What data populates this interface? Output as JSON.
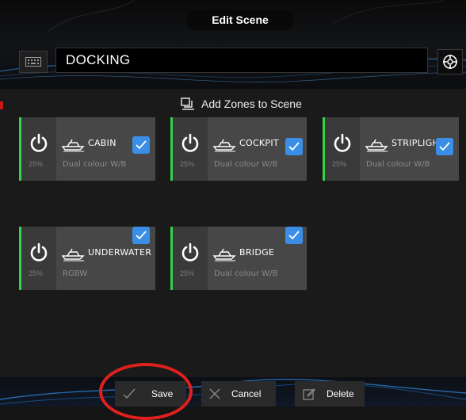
{
  "header": {
    "title": "Edit Scene",
    "scene_name": "DOCKING"
  },
  "main": {
    "add_zones_label": "Add Zones to Scene",
    "zones": [
      {
        "name": "CABIN",
        "type": "Dual colour W/B",
        "level": "25%",
        "selected": true
      },
      {
        "name": "COCKPIT",
        "type": "Dual colour W/B",
        "level": "25%",
        "selected": true
      },
      {
        "name": "STRIPLIGHT",
        "type": "Dual colour W/B",
        "level": "25%",
        "selected": true
      },
      {
        "name": "UNDERWATER",
        "type": "RGBW",
        "level": "25%",
        "selected": true
      },
      {
        "name": "BRIDGE",
        "type": "Dual colour W/B",
        "level": "25%",
        "selected": true
      }
    ]
  },
  "footer": {
    "save_label": "Save",
    "cancel_label": "Cancel",
    "delete_label": "Delete"
  },
  "colors": {
    "accent_check": "#3a8ee6",
    "zone_active_bar": "#35d34a",
    "highlight_circle": "#e0201d"
  },
  "icons": [
    "keyboard-icon",
    "target-icon",
    "layers-icon",
    "power-icon",
    "boat-icon",
    "checkmark-icon",
    "close-icon",
    "edit-icon"
  ]
}
